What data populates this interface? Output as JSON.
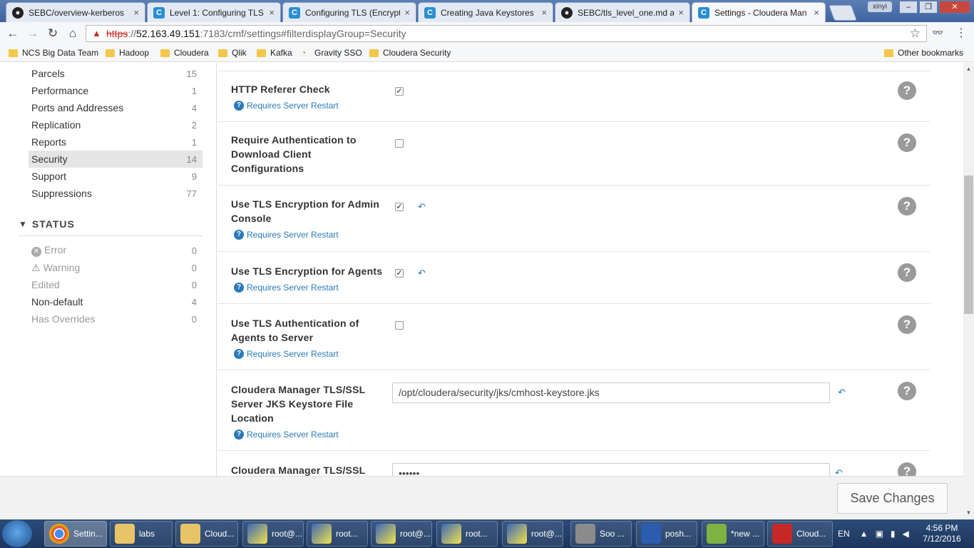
{
  "browser": {
    "tabs": [
      {
        "title": "SEBC/overview-kerberos",
        "icon": "github-icon",
        "active": false
      },
      {
        "title": "Level 1: Configuring TLS",
        "icon": "cloudera-icon",
        "active": false
      },
      {
        "title": "Configuring TLS (Encrypti",
        "icon": "cloudera-icon",
        "active": false
      },
      {
        "title": "Creating Java Keystores",
        "icon": "cloudera-icon",
        "active": false
      },
      {
        "title": "SEBC/tls_level_one.md a",
        "icon": "github-icon",
        "active": false
      },
      {
        "title": "Settings - Cloudera Man",
        "icon": "cloudera-icon",
        "active": true
      }
    ],
    "user": "xinyi",
    "url": {
      "scheme": "https",
      "sep": "://",
      "host": "52.163.49.151",
      "path": ":7183/cmf/settings#filterdisplayGroup=Security"
    },
    "bookmarks": [
      "NCS Big Data Team",
      "Hadoop",
      "Cloudera",
      "Qlik",
      "Kafka",
      "Gravity SSO",
      "Cloudera Security"
    ],
    "other_bookmarks": "Other bookmarks"
  },
  "sidebar": {
    "categories": [
      {
        "label": "Parcels",
        "count": "15"
      },
      {
        "label": "Performance",
        "count": "1"
      },
      {
        "label": "Ports and Addresses",
        "count": "4"
      },
      {
        "label": "Replication",
        "count": "2"
      },
      {
        "label": "Reports",
        "count": "1"
      },
      {
        "label": "Security",
        "count": "14",
        "selected": true
      },
      {
        "label": "Support",
        "count": "9"
      },
      {
        "label": "Suppressions",
        "count": "77"
      }
    ],
    "status_header": "STATUS",
    "status": [
      {
        "label": "Error",
        "count": "0"
      },
      {
        "label": "Warning",
        "count": "0"
      },
      {
        "label": "Edited",
        "count": "0"
      },
      {
        "label": "Non-default",
        "count": "4"
      },
      {
        "label": "Has Overrides",
        "count": "0"
      }
    ]
  },
  "settings": {
    "restart_label": "Requires Server Restart",
    "rows": [
      {
        "name": "HTTP Referer Check",
        "checked": true
      },
      {
        "name": "Require Authentication to Download Client Configurations",
        "checked": false
      },
      {
        "name": "Use TLS Encryption for Admin Console",
        "checked": true
      },
      {
        "name": "Use TLS Encryption for Agents",
        "checked": true
      },
      {
        "name": "Use TLS Authentication of Agents to Server",
        "checked": false
      },
      {
        "name": "Cloudera Manager TLS/SSL Server JKS Keystore File Location",
        "value": "/opt/cloudera/security/jks/cmhost-keystore.jks"
      },
      {
        "name": "Cloudera Manager TLS/SSL",
        "value": "••••••"
      }
    ]
  },
  "footer": {
    "save_label": "Save Changes"
  },
  "taskbar": {
    "items": [
      "Settin...",
      "labs",
      "Cloud...",
      "root@...",
      "root...",
      "root@...",
      "root...",
      "root@...",
      "Soo ...",
      "posh...",
      "*new ...",
      "Cloud..."
    ],
    "lang": "EN",
    "time": "4:56 PM",
    "date": "7/12/2016"
  }
}
